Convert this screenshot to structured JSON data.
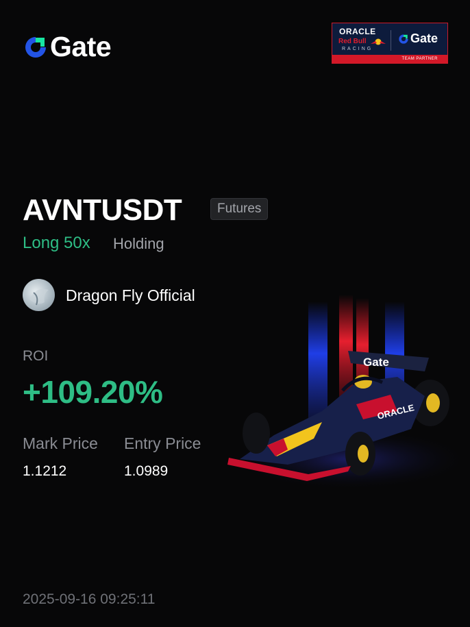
{
  "brand": {
    "name": "Gate",
    "logo_icon": "gate-logo-icon",
    "colors": {
      "logo_blue": "#2354e6",
      "logo_green": "#17e6a1"
    }
  },
  "partner": {
    "oracle": "ORACLE",
    "red_bull": "Red Bull",
    "racing": "RACING",
    "gate": "Gate",
    "strip": "TEAM PARTNER"
  },
  "position": {
    "symbol": "AVNTUSDT",
    "type_badge": "Futures",
    "side": "Long 50x",
    "status": "Holding"
  },
  "user": {
    "name": "Dragon Fly Official",
    "avatar_icon": "user-avatar"
  },
  "stats": {
    "roi_label": "ROI",
    "roi_value": "+109.20%",
    "mark_price_label": "Mark Price",
    "mark_price_value": "1.1212",
    "entry_price_label": "Entry Price",
    "entry_price_value": "1.0989"
  },
  "timestamp": "2025-09-16 09:25:11",
  "colors": {
    "background": "#070708",
    "profit_green": "#2ebd85",
    "muted_text": "#8a8c93"
  },
  "illustration": {
    "wing_text": "Gate",
    "sidepod_text": "ORACLE"
  }
}
